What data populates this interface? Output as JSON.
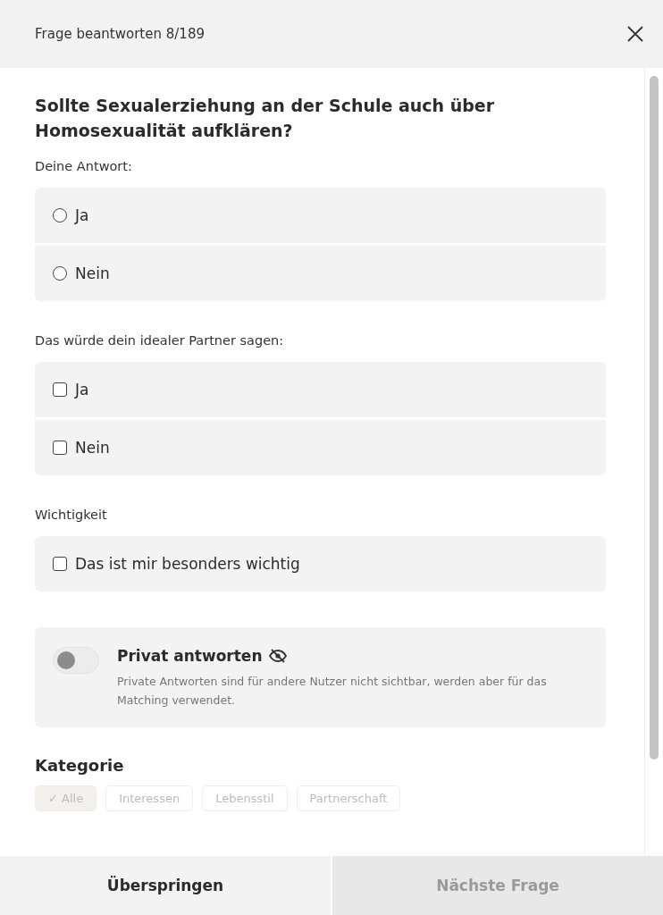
{
  "header": {
    "title": "Frage beantworten 8/189"
  },
  "question": "Sollte Sexualerziehung an der Schule auch über Homosexualität aufklären?",
  "answer": {
    "label": "Deine Antwort:",
    "options": [
      {
        "label": "Ja",
        "selected": false
      },
      {
        "label": "Nein",
        "selected": false
      }
    ]
  },
  "partner": {
    "label": "Das würde dein idealer Partner sagen:",
    "options": [
      {
        "label": "Ja",
        "checked": false
      },
      {
        "label": "Nein",
        "checked": false
      }
    ]
  },
  "importance": {
    "label": "Wichtigkeit",
    "options": [
      {
        "label": "Das ist mir besonders wichtig",
        "checked": false
      }
    ]
  },
  "private": {
    "title": "Privat antworten",
    "on": false,
    "description": "Private Antworten sind für andere Nutzer nicht sichtbar, werden aber für das Matching verwendet."
  },
  "category": {
    "label": "Kategorie",
    "chips": [
      {
        "label": "✓ Alle",
        "selected": true
      },
      {
        "label": "Interessen",
        "selected": false
      },
      {
        "label": "Lebensstil",
        "selected": false
      },
      {
        "label": "Partnerschaft",
        "selected": false
      }
    ]
  },
  "footer": {
    "skip": "Überspringen",
    "next": {
      "label": "Nächste Frage",
      "disabled": true
    }
  }
}
